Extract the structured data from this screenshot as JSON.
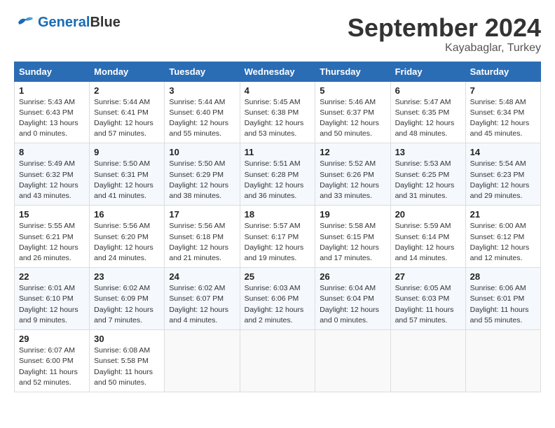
{
  "logo": {
    "name_part1": "General",
    "name_part2": "Blue"
  },
  "title": "September 2024",
  "location": "Kayabaglar, Turkey",
  "days_of_week": [
    "Sunday",
    "Monday",
    "Tuesday",
    "Wednesday",
    "Thursday",
    "Friday",
    "Saturday"
  ],
  "weeks": [
    [
      {
        "day": "1",
        "info": "Sunrise: 5:43 AM\nSunset: 6:43 PM\nDaylight: 13 hours\nand 0 minutes."
      },
      {
        "day": "2",
        "info": "Sunrise: 5:44 AM\nSunset: 6:41 PM\nDaylight: 12 hours\nand 57 minutes."
      },
      {
        "day": "3",
        "info": "Sunrise: 5:44 AM\nSunset: 6:40 PM\nDaylight: 12 hours\nand 55 minutes."
      },
      {
        "day": "4",
        "info": "Sunrise: 5:45 AM\nSunset: 6:38 PM\nDaylight: 12 hours\nand 53 minutes."
      },
      {
        "day": "5",
        "info": "Sunrise: 5:46 AM\nSunset: 6:37 PM\nDaylight: 12 hours\nand 50 minutes."
      },
      {
        "day": "6",
        "info": "Sunrise: 5:47 AM\nSunset: 6:35 PM\nDaylight: 12 hours\nand 48 minutes."
      },
      {
        "day": "7",
        "info": "Sunrise: 5:48 AM\nSunset: 6:34 PM\nDaylight: 12 hours\nand 45 minutes."
      }
    ],
    [
      {
        "day": "8",
        "info": "Sunrise: 5:49 AM\nSunset: 6:32 PM\nDaylight: 12 hours\nand 43 minutes."
      },
      {
        "day": "9",
        "info": "Sunrise: 5:50 AM\nSunset: 6:31 PM\nDaylight: 12 hours\nand 41 minutes."
      },
      {
        "day": "10",
        "info": "Sunrise: 5:50 AM\nSunset: 6:29 PM\nDaylight: 12 hours\nand 38 minutes."
      },
      {
        "day": "11",
        "info": "Sunrise: 5:51 AM\nSunset: 6:28 PM\nDaylight: 12 hours\nand 36 minutes."
      },
      {
        "day": "12",
        "info": "Sunrise: 5:52 AM\nSunset: 6:26 PM\nDaylight: 12 hours\nand 33 minutes."
      },
      {
        "day": "13",
        "info": "Sunrise: 5:53 AM\nSunset: 6:25 PM\nDaylight: 12 hours\nand 31 minutes."
      },
      {
        "day": "14",
        "info": "Sunrise: 5:54 AM\nSunset: 6:23 PM\nDaylight: 12 hours\nand 29 minutes."
      }
    ],
    [
      {
        "day": "15",
        "info": "Sunrise: 5:55 AM\nSunset: 6:21 PM\nDaylight: 12 hours\nand 26 minutes."
      },
      {
        "day": "16",
        "info": "Sunrise: 5:56 AM\nSunset: 6:20 PM\nDaylight: 12 hours\nand 24 minutes."
      },
      {
        "day": "17",
        "info": "Sunrise: 5:56 AM\nSunset: 6:18 PM\nDaylight: 12 hours\nand 21 minutes."
      },
      {
        "day": "18",
        "info": "Sunrise: 5:57 AM\nSunset: 6:17 PM\nDaylight: 12 hours\nand 19 minutes."
      },
      {
        "day": "19",
        "info": "Sunrise: 5:58 AM\nSunset: 6:15 PM\nDaylight: 12 hours\nand 17 minutes."
      },
      {
        "day": "20",
        "info": "Sunrise: 5:59 AM\nSunset: 6:14 PM\nDaylight: 12 hours\nand 14 minutes."
      },
      {
        "day": "21",
        "info": "Sunrise: 6:00 AM\nSunset: 6:12 PM\nDaylight: 12 hours\nand 12 minutes."
      }
    ],
    [
      {
        "day": "22",
        "info": "Sunrise: 6:01 AM\nSunset: 6:10 PM\nDaylight: 12 hours\nand 9 minutes."
      },
      {
        "day": "23",
        "info": "Sunrise: 6:02 AM\nSunset: 6:09 PM\nDaylight: 12 hours\nand 7 minutes."
      },
      {
        "day": "24",
        "info": "Sunrise: 6:02 AM\nSunset: 6:07 PM\nDaylight: 12 hours\nand 4 minutes."
      },
      {
        "day": "25",
        "info": "Sunrise: 6:03 AM\nSunset: 6:06 PM\nDaylight: 12 hours\nand 2 minutes."
      },
      {
        "day": "26",
        "info": "Sunrise: 6:04 AM\nSunset: 6:04 PM\nDaylight: 12 hours\nand 0 minutes."
      },
      {
        "day": "27",
        "info": "Sunrise: 6:05 AM\nSunset: 6:03 PM\nDaylight: 11 hours\nand 57 minutes."
      },
      {
        "day": "28",
        "info": "Sunrise: 6:06 AM\nSunset: 6:01 PM\nDaylight: 11 hours\nand 55 minutes."
      }
    ],
    [
      {
        "day": "29",
        "info": "Sunrise: 6:07 AM\nSunset: 6:00 PM\nDaylight: 11 hours\nand 52 minutes."
      },
      {
        "day": "30",
        "info": "Sunrise: 6:08 AM\nSunset: 5:58 PM\nDaylight: 11 hours\nand 50 minutes."
      },
      {
        "day": "",
        "info": ""
      },
      {
        "day": "",
        "info": ""
      },
      {
        "day": "",
        "info": ""
      },
      {
        "day": "",
        "info": ""
      },
      {
        "day": "",
        "info": ""
      }
    ]
  ]
}
